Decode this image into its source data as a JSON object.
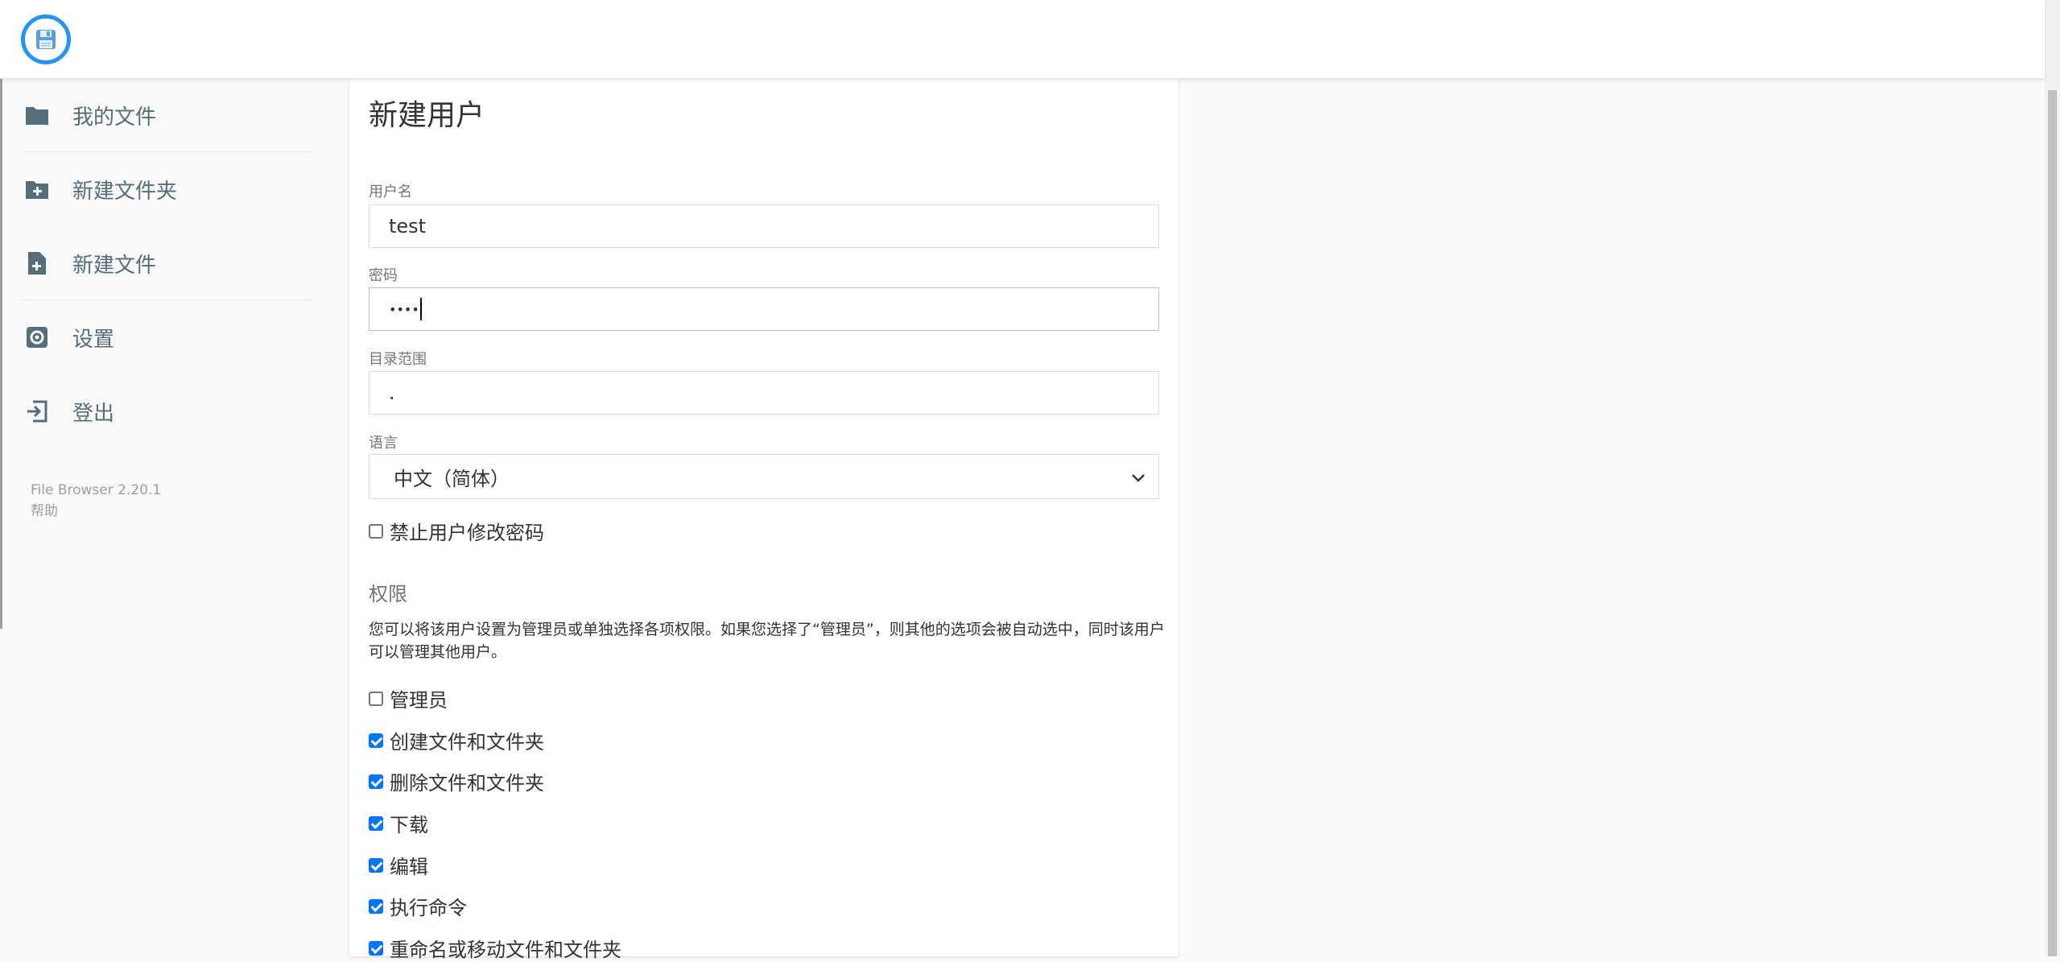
{
  "header": {
    "logo_icon": "floppy-disk-icon",
    "accent_color": "#2196f3"
  },
  "sidebar": {
    "items": [
      {
        "label": "我的文件",
        "icon": "folder-icon"
      },
      {
        "label": "新建文件夹",
        "icon": "folder-plus-icon"
      },
      {
        "label": "新建文件",
        "icon": "file-plus-icon"
      },
      {
        "label": "设置",
        "icon": "gear-icon"
      },
      {
        "label": "登出",
        "icon": "logout-icon"
      }
    ],
    "credits": {
      "version": "File Browser 2.20.1",
      "help": "帮助"
    }
  },
  "form": {
    "title": "新建用户",
    "username": {
      "label": "用户名",
      "value": "test"
    },
    "password": {
      "label": "密码",
      "value": "••••"
    },
    "scope": {
      "label": "目录范围",
      "value": "."
    },
    "language": {
      "label": "语言",
      "value": "中文（简体）"
    },
    "lock_password": {
      "label": "禁止用户修改密码",
      "checked": false
    },
    "permissions": {
      "title": "权限",
      "description": "您可以将该用户设置为管理员或单独选择各项权限。如果您选择了“管理员”，则其他的选项会被自动选中，同时该用户可以管理其他用户。",
      "items": [
        {
          "label": "管理员",
          "checked": false
        },
        {
          "label": "创建文件和文件夹",
          "checked": true
        },
        {
          "label": "删除文件和文件夹",
          "checked": true
        },
        {
          "label": "下载",
          "checked": true
        },
        {
          "label": "编辑",
          "checked": true
        },
        {
          "label": "执行命令",
          "checked": true
        },
        {
          "label": "重命名或移动文件和文件夹",
          "checked": true
        }
      ]
    }
  }
}
